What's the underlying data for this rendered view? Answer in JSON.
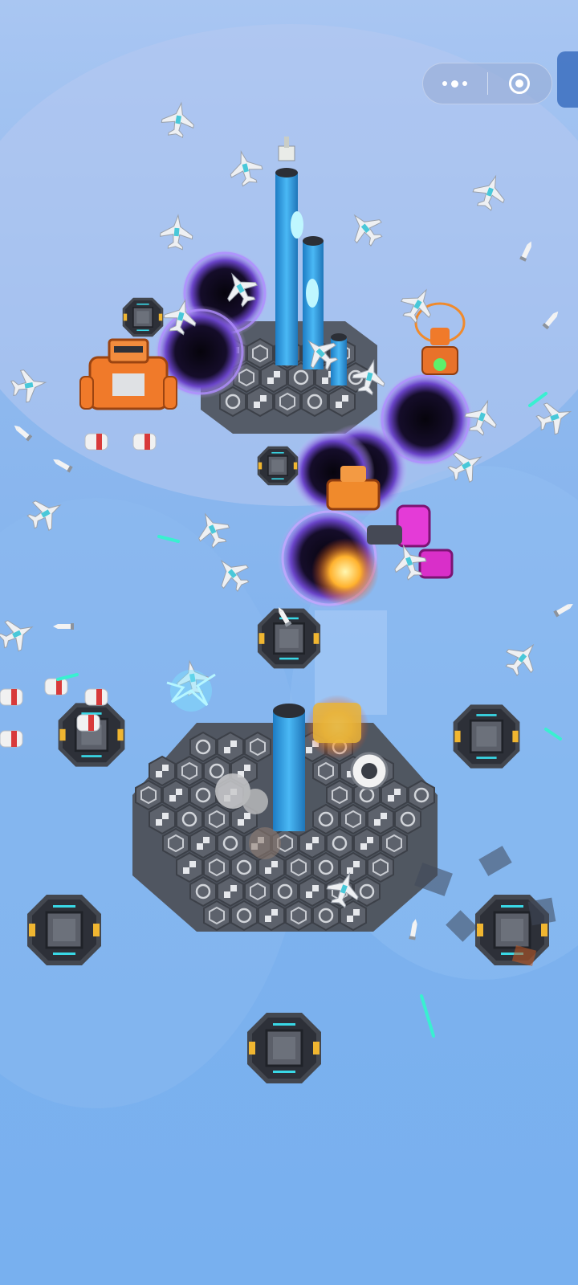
{
  "screen": "tower-defense-battlefield",
  "colors": {
    "sky": "#8eb8ee",
    "platform": "#565b66",
    "tower": "#2f9be0",
    "portal": "#1a1030",
    "portal_glow": "#9a6cff",
    "robot_orange": "#f07a2a",
    "robot_magenta": "#e43bd7",
    "laser": "#39f0d0"
  },
  "capsule_menu": {
    "more_icon": "more-dots-icon",
    "close_icon": "target-circle-icon"
  },
  "entities": {
    "portals": 5,
    "pads": 8,
    "enemy_jets": 22,
    "towers": 4
  }
}
